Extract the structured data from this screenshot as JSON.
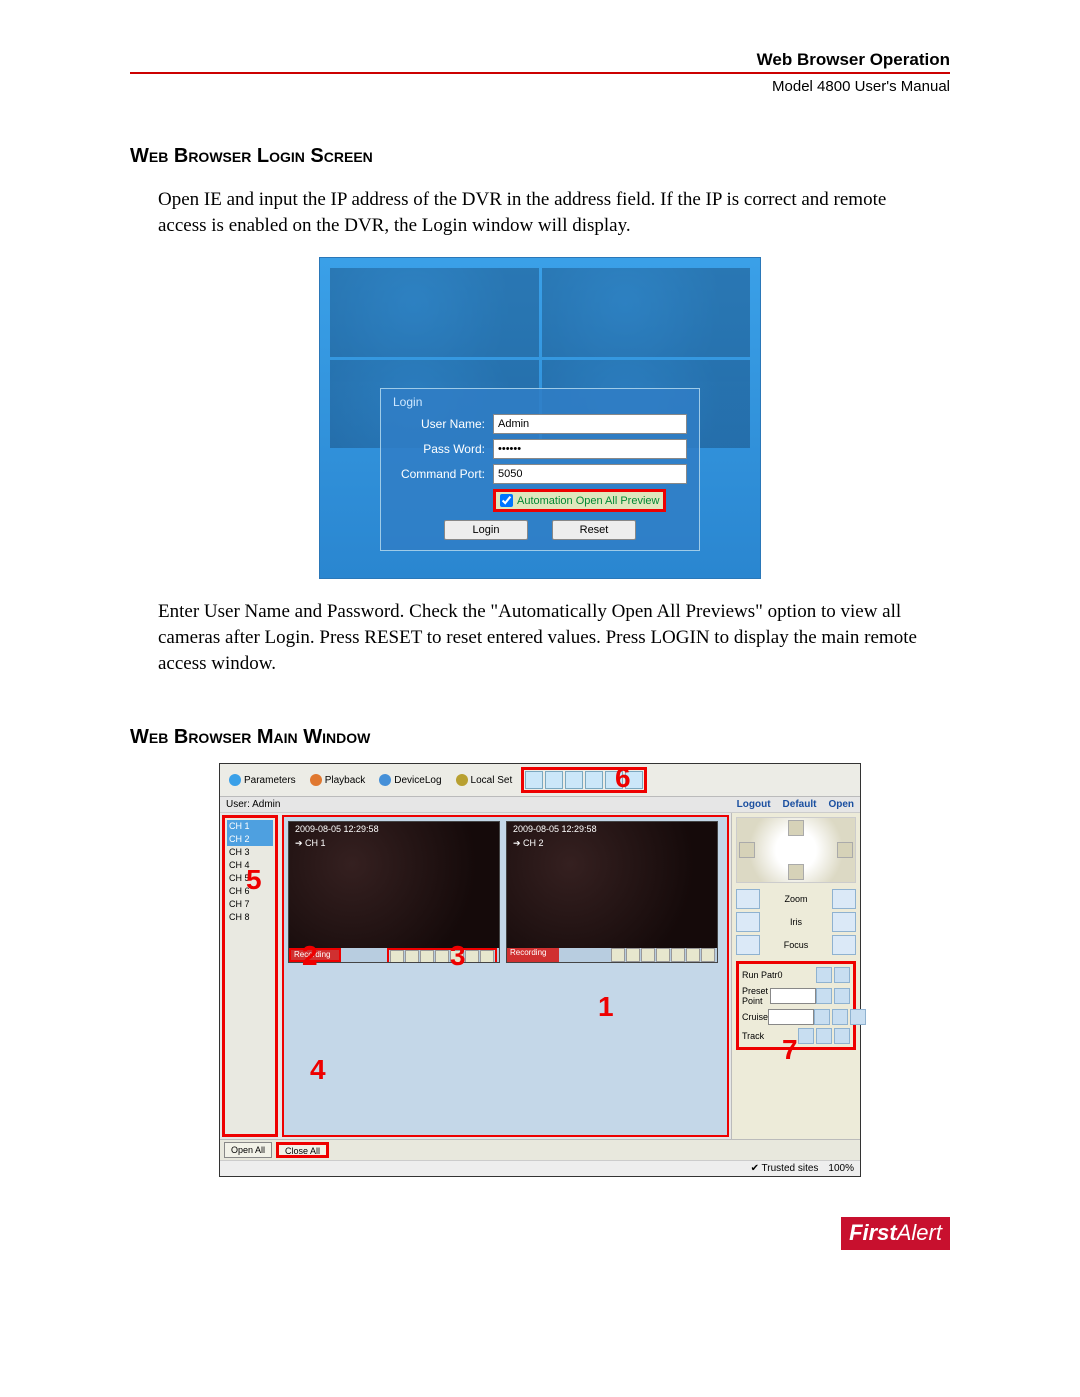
{
  "header": {
    "title": "Web Browser Operation",
    "subtitle": "Model 4800 User's Manual"
  },
  "section1": {
    "heading": "Web Browser Login Screen",
    "para1": "Open IE and input the IP address of the DVR in the address field. If the IP is correct and remote access is enabled on the DVR, the Login window will display.",
    "para2": "Enter User Name and Password. Check the \"Automatically Open All Previews\" option to view all cameras after Login. Press RESET to reset entered values. Press LOGIN to display the main remote access window."
  },
  "login_fig": {
    "box_title": "Login",
    "user_label": "User Name:",
    "user_value": "Admin",
    "pass_label": "Pass Word:",
    "pass_value": "••••••",
    "port_label": "Command Port:",
    "port_value": "5050",
    "auto_label": "Automation Open All Preview",
    "login_btn": "Login",
    "reset_btn": "Reset"
  },
  "section2": {
    "heading": "Web Browser Main Window"
  },
  "main_fig": {
    "toolbar": {
      "parameters": "Parameters",
      "playback": "Playback",
      "devicelog": "DeviceLog",
      "localset": "Local Set"
    },
    "userbar": {
      "user_label": "User: Admin",
      "logout": "Logout",
      "default": "Default",
      "open": "Open"
    },
    "channels": [
      "CH 1",
      "CH 2",
      "CH 3",
      "CH 4",
      "CH 5",
      "CH 6",
      "CH 7",
      "CH 8"
    ],
    "tile_timestamp": "2009-08-05 12:29:58",
    "tile1_ch": "➔ CH 1",
    "tile2_ch": "➔ CH 2",
    "recording": "Recording",
    "right_panel": {
      "zoom": "Zoom",
      "iris": "Iris",
      "focus": "Focus",
      "run_patr": "Run Patr0",
      "preset_point": "Preset Point",
      "cruise": "Cruise",
      "track": "Track"
    },
    "bottom": {
      "open_all": "Open All",
      "close_all": "Close All"
    },
    "statusbar": {
      "trusted": "Trusted sites",
      "zoom": "100%"
    },
    "callouts": {
      "c1": "1",
      "c2": "2",
      "c3": "3",
      "c4": "4",
      "c5": "5",
      "c6": "6",
      "c7": "7"
    }
  },
  "footer": {
    "brand_a": "First",
    "brand_b": "Alert"
  }
}
